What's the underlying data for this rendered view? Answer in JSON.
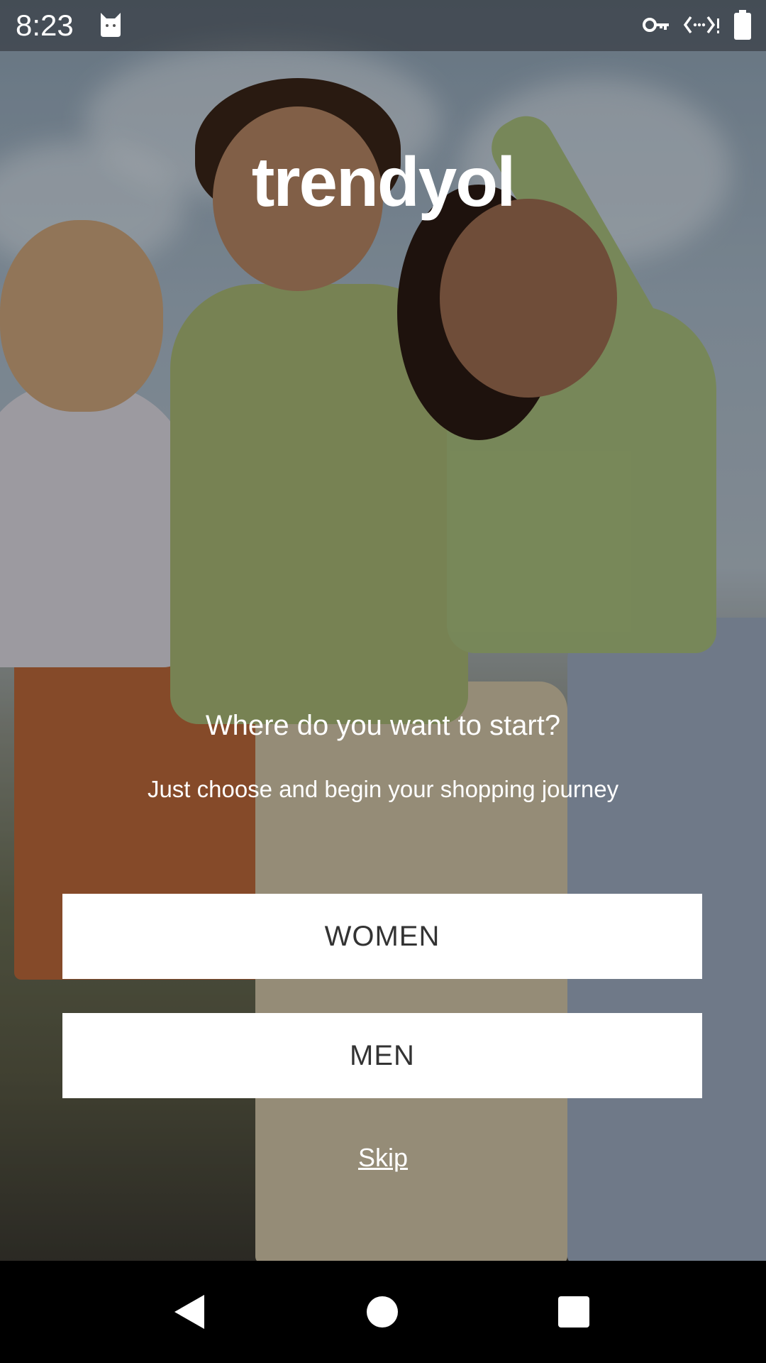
{
  "status_bar": {
    "time": "8:23",
    "icons": [
      "cat-icon",
      "key-icon",
      "data-saver-icon",
      "battery-icon"
    ]
  },
  "logo": {
    "text": "trendyol"
  },
  "onboarding": {
    "headline": "Where do you want to start?",
    "subline": "Just choose and begin your shopping journey",
    "women_label": "WOMEN",
    "men_label": "MEN",
    "skip_label": "Skip"
  },
  "nav": {
    "icons": [
      "back-icon",
      "home-icon",
      "recents-icon"
    ]
  },
  "colors": {
    "button_bg": "#ffffff",
    "button_text": "#333333",
    "nav_bg": "#000000"
  }
}
